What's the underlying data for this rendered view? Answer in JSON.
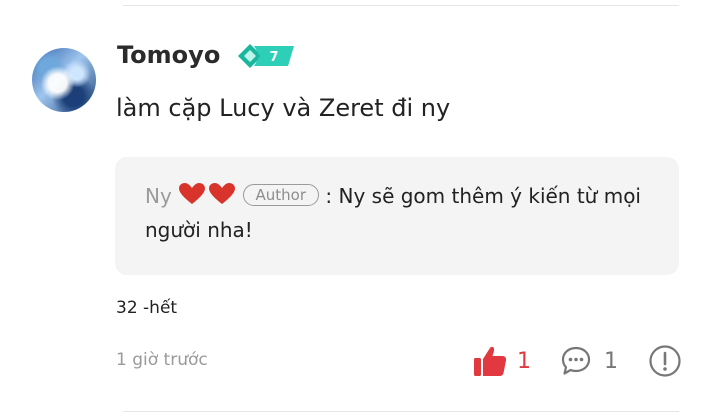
{
  "comment": {
    "username": "Tomoyo",
    "level_badge": "7",
    "text": "làm cặp Lucy và Zeret đi ny",
    "extra_note": "32 -hết",
    "timestamp": "1 giờ trước",
    "like_count": "1",
    "reply_count": "1"
  },
  "reply": {
    "author": "Ny",
    "author_tag": "Author",
    "separator": ":",
    "text": "Ny sẽ gom thêm ý kiến từ mọi người nha!"
  },
  "colors": {
    "like_active": "#e2383f",
    "badge": "#2dd0b7",
    "muted_text": "#9a9a9a",
    "reply_bg": "#f4f4f5"
  },
  "icons": [
    "heart-icon",
    "heart-icon",
    "thumbs-up-icon",
    "comment-bubble-icon",
    "report-icon"
  ]
}
